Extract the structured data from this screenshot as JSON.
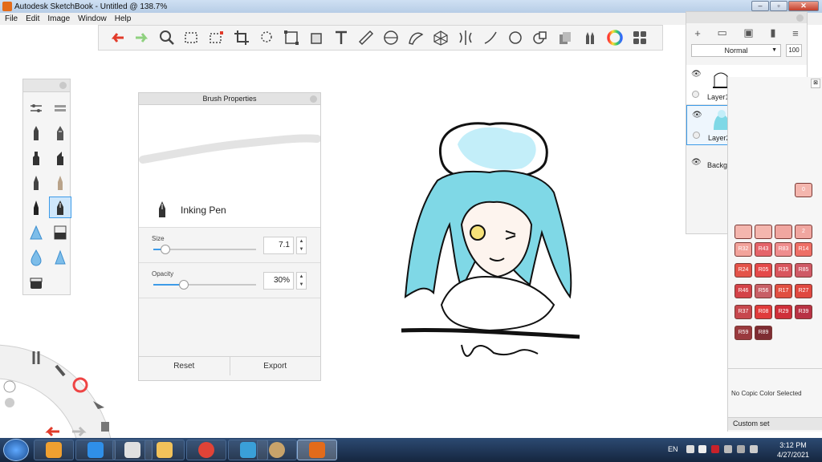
{
  "window": {
    "title": "Autodesk SketchBook - Untitled @ 138.7%",
    "controls": [
      "–",
      "▫",
      "✕"
    ]
  },
  "menu": [
    "File",
    "Edit",
    "Image",
    "Window",
    "Help"
  ],
  "toolbar": {
    "tools": [
      "undo-icon",
      "redo-icon",
      "zoom-icon",
      "selection-icon",
      "crop-selection-icon",
      "crop-icon",
      "lasso-select-icon",
      "distort-icon",
      "bucket-fill-icon",
      "text-icon",
      "ruler-icon",
      "ellipse-guide-icon",
      "french-curve-icon",
      "perspective-icon",
      "symmetry-icon",
      "line-icon",
      "circle-icon",
      "shape-icon",
      "copic-library-icon",
      "brush-library-icon",
      "color-wheel-icon",
      "layer-editor-icon"
    ]
  },
  "palette": {
    "tools": [
      "pencil",
      "ballpoint-pen",
      "marker",
      "chisel-marker",
      "brush",
      "airbrush",
      "inking-pen",
      "fountain-pen",
      "smudge",
      "eraser",
      "blur",
      "triangle-eraser",
      "solid-block"
    ],
    "selected": "fountain-pen"
  },
  "brush_properties": {
    "title": "Brush Properties",
    "brush_name": "Inking Pen",
    "size": {
      "label": "Size",
      "value": "7.1",
      "level": 0.12
    },
    "opacity": {
      "label": "Opacity",
      "value": "30%",
      "level": 0.3
    },
    "reset_label": "Reset",
    "export_label": "Export"
  },
  "layers": {
    "toolbar_icons": [
      "+",
      "▭",
      "▣",
      "▮",
      "≡"
    ],
    "blend_mode": "Normal",
    "opacity": "100",
    "items": [
      {
        "name": "Layer1",
        "selected": false
      },
      {
        "name": "Layer2",
        "selected": true
      },
      {
        "name": "Background",
        "selected": false
      }
    ]
  },
  "copic": {
    "swatches": [
      {
        "code": "R32",
        "color": "#f2a39b"
      },
      {
        "code": "R43",
        "color": "#e5646a"
      },
      {
        "code": "R83",
        "color": "#ef8d8e"
      },
      {
        "code": "R14",
        "color": "#ee6f66"
      },
      {
        "code": "R24",
        "color": "#e45349"
      },
      {
        "code": "R05",
        "color": "#e5494a"
      },
      {
        "code": "R35",
        "color": "#d9555d"
      },
      {
        "code": "R85",
        "color": "#cf5a66"
      },
      {
        "code": "R46",
        "color": "#d44248"
      },
      {
        "code": "R56",
        "color": "#c85f66"
      },
      {
        "code": "R17",
        "color": "#e14f41"
      },
      {
        "code": "R27",
        "color": "#e04840"
      },
      {
        "code": "R37",
        "color": "#c7474d"
      },
      {
        "code": "R08",
        "color": "#e03b3b"
      },
      {
        "code": "R29",
        "color": "#cf2f3a"
      },
      {
        "code": "R39",
        "color": "#b83244"
      },
      {
        "code": "R59",
        "color": "#9a3a3e"
      },
      {
        "code": "R89",
        "color": "#7e2d33"
      }
    ],
    "partial_row": [
      "0",
      "2"
    ],
    "no_color_text": "No Copic Color Selected",
    "custom_set_label": "Custom set"
  },
  "taskbar": {
    "apps": [
      "media-player-icon",
      "internet-explorer-icon",
      "paint-icon",
      "folder-icon",
      "chrome-icon",
      "photo-viewer-icon",
      "paint-palette-icon",
      "sketchbook-icon"
    ],
    "active_app": "sketchbook-icon",
    "language": "EN",
    "time": "3:12 PM",
    "date": "4/27/2021"
  }
}
